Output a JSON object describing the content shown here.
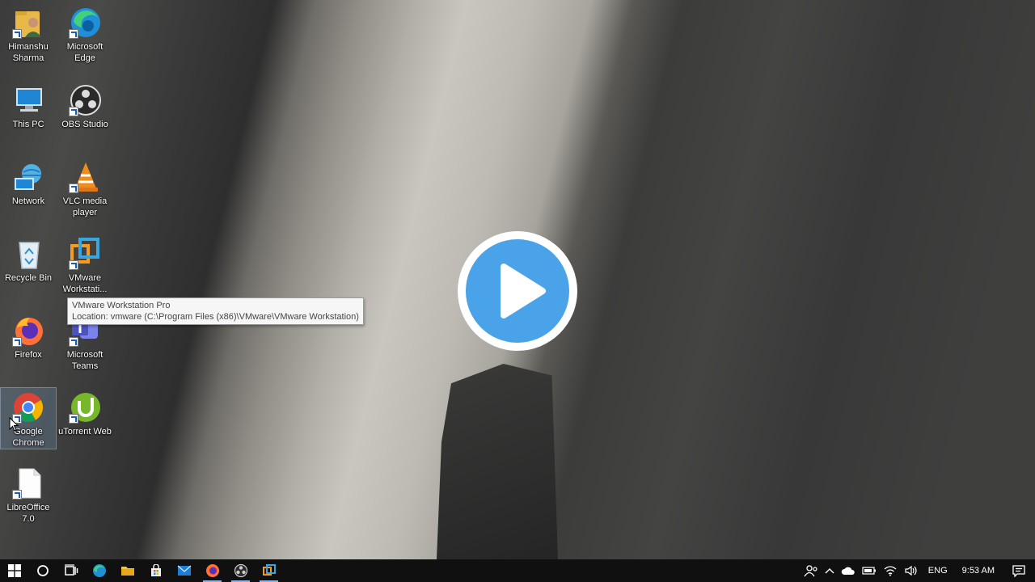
{
  "desktop": {
    "icons": [
      {
        "label": "Himanshu Sharma",
        "icon": "user-folder-icon"
      },
      {
        "label": "Microsoft Edge",
        "icon": "edge-icon"
      },
      {
        "label": "This PC",
        "icon": "computer-icon"
      },
      {
        "label": "OBS Studio",
        "icon": "obs-icon"
      },
      {
        "label": "Network",
        "icon": "network-icon"
      },
      {
        "label": "VLC media player",
        "icon": "vlc-icon"
      },
      {
        "label": "Recycle Bin",
        "icon": "recycle-bin-icon"
      },
      {
        "label": "VMware Workstati...",
        "icon": "vmware-icon"
      },
      {
        "label": "Firefox",
        "icon": "firefox-icon"
      },
      {
        "label": "Microsoft Teams",
        "icon": "teams-icon"
      },
      {
        "label": "Google Chrome",
        "icon": "chrome-icon"
      },
      {
        "label": "uTorrent Web",
        "icon": "utorrent-icon"
      },
      {
        "label": "LibreOffice 7.0",
        "icon": "libreoffice-icon"
      }
    ]
  },
  "tooltip": {
    "line1": "VMware Workstation Pro",
    "line2": "Location: vmware (C:\\Program Files (x86)\\VMware\\VMware Workstation)"
  },
  "video": {
    "play_icon": "play-icon",
    "accent": "#4aa3e8"
  },
  "taskbar": {
    "pinned": [
      "start-icon",
      "search-icon",
      "task-view-icon",
      "edge-icon",
      "file-explorer-icon",
      "store-icon",
      "mail-icon",
      "firefox-icon",
      "obs-icon",
      "vmware-icon"
    ],
    "tray": {
      "language": "ENG",
      "time": "9:53 AM"
    }
  }
}
